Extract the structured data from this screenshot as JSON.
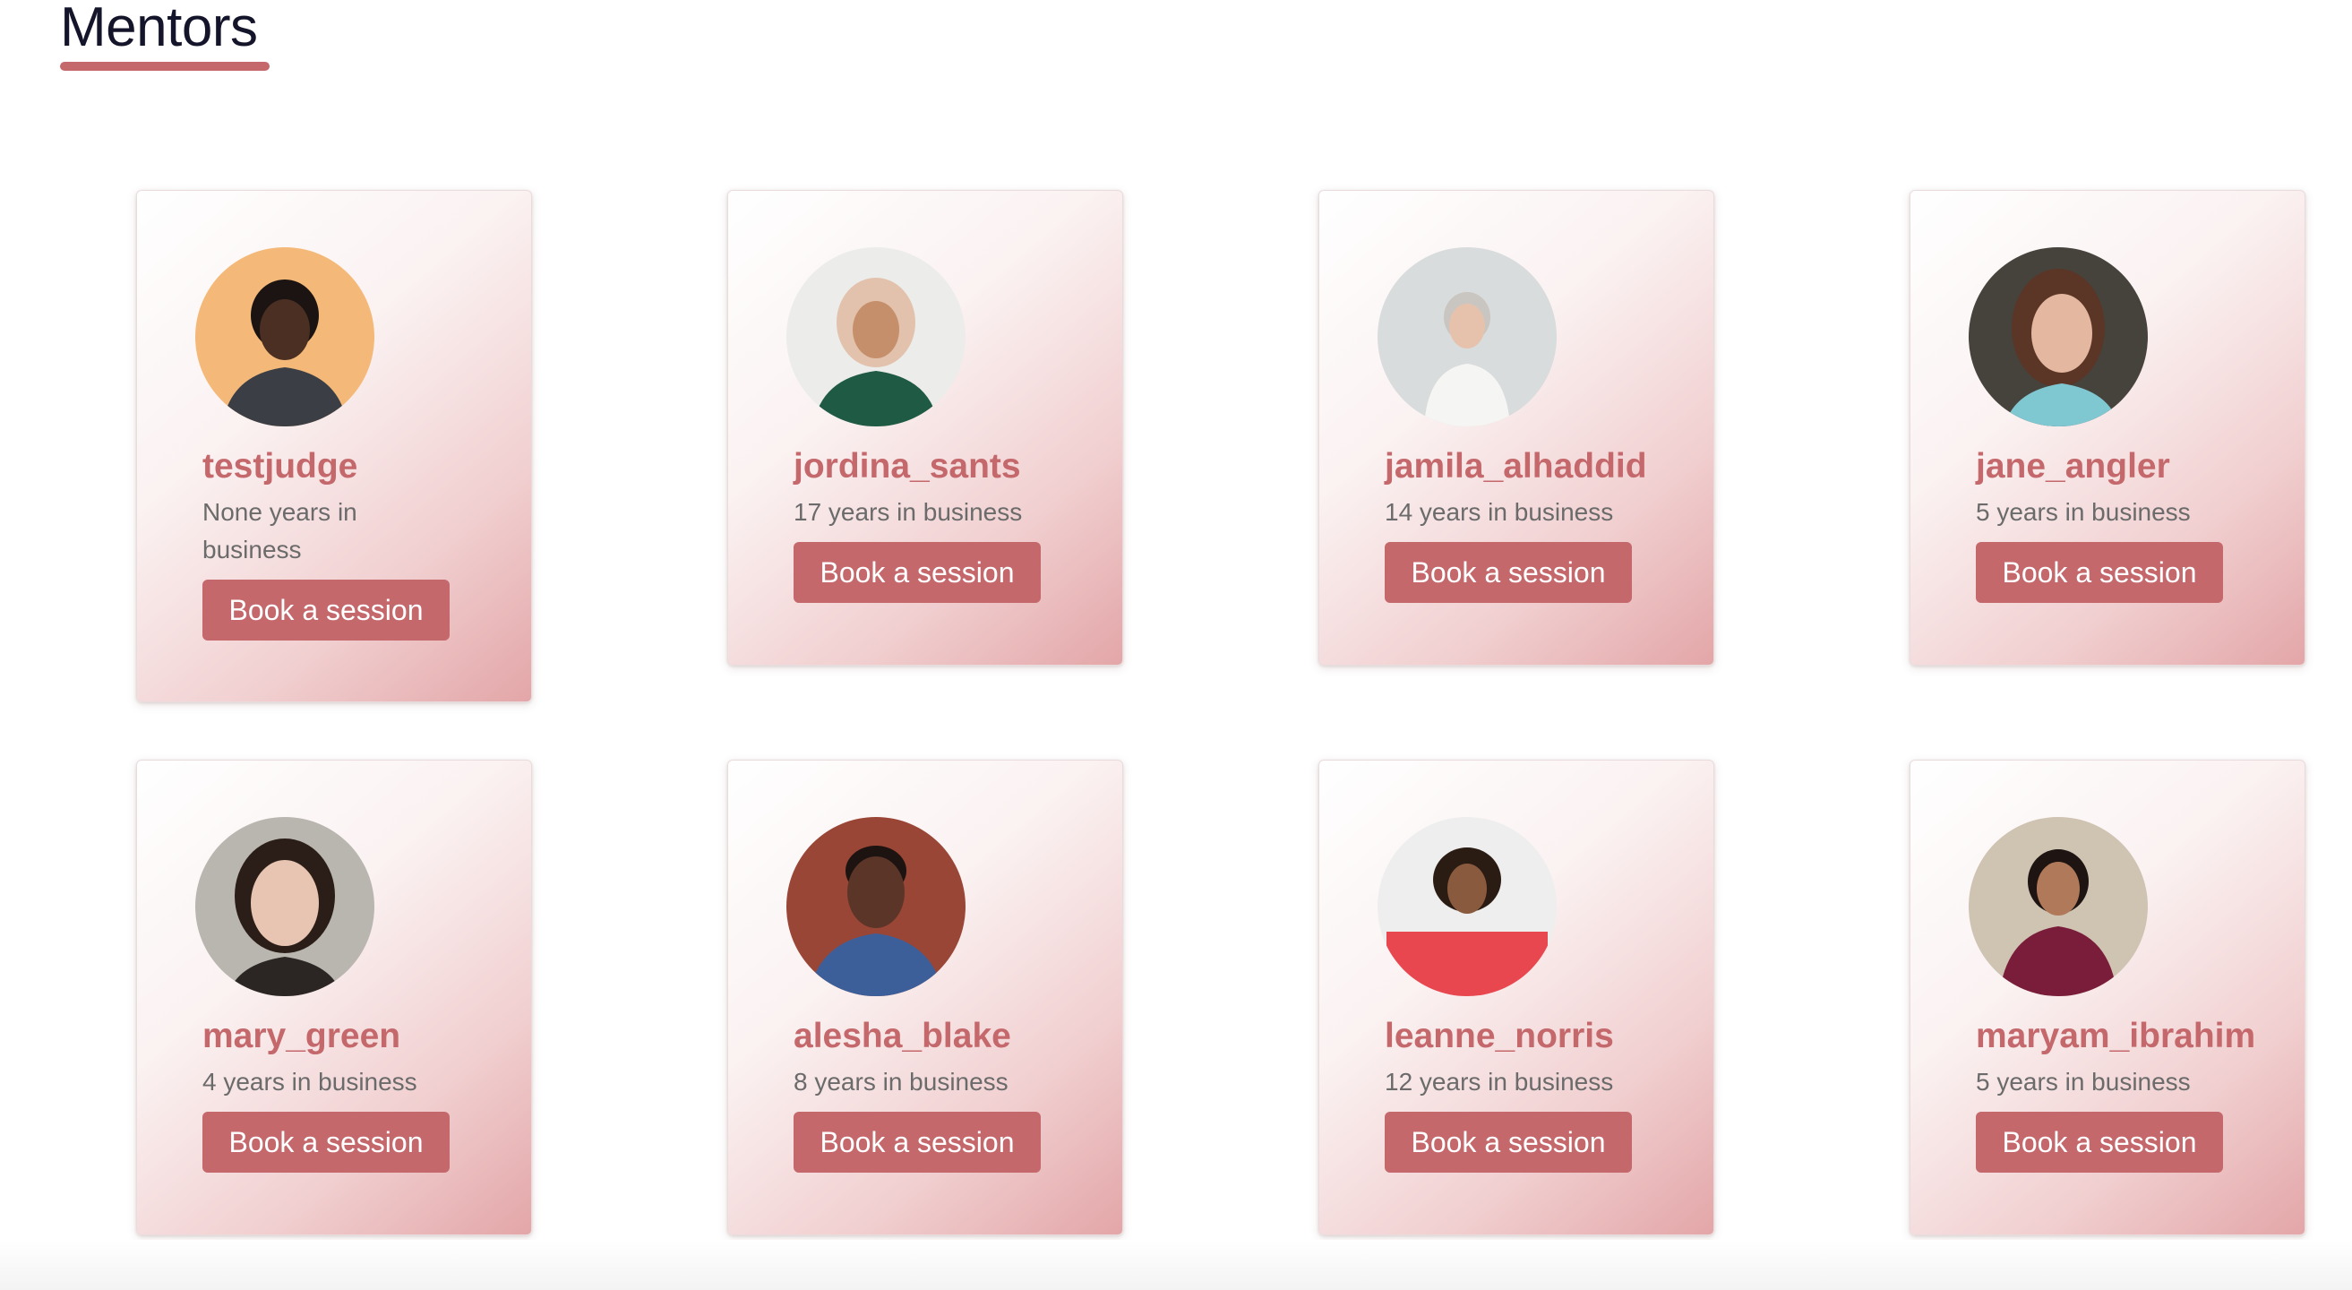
{
  "page": {
    "title": "Mentors"
  },
  "mentors": [
    {
      "name": "testjudge",
      "years": "None years in business",
      "button": "Book a session",
      "photo_bg": "#f4b978",
      "photo_skin": "#4a2f22",
      "photo_cloth": "#3b3f45",
      "photo_hair": "#1b1412"
    },
    {
      "name": "jordina_sants",
      "years": "17 years in business",
      "button": "Book a session",
      "photo_bg": "#ececea",
      "photo_skin": "#c68f6b",
      "photo_cloth": "#1f5a45",
      "photo_hair": "#e2c2ac"
    },
    {
      "name": "jamila_alhaddid",
      "years": "14 years in business",
      "button": "Book a session",
      "photo_bg": "#d9dcdc",
      "photo_skin": "#e6c2ad",
      "photo_cloth": "#f5f5f3",
      "photo_hair": "#c9c6c1"
    },
    {
      "name": "jane_angler",
      "years": "5 years in business",
      "button": "Book a session",
      "photo_bg": "#46423c",
      "photo_skin": "#e3b7a0",
      "photo_cloth": "#7fc7d1",
      "photo_hair": "#5b3526"
    },
    {
      "name": "mary_green",
      "years": "4 years in business",
      "button": "Book a session",
      "photo_bg": "#b9b6b0",
      "photo_skin": "#e8c5b2",
      "photo_cloth": "#2b2623",
      "photo_hair": "#2b1e18"
    },
    {
      "name": "alesha_blake",
      "years": "8 years in business",
      "button": "Book a session",
      "photo_bg": "#9a4637",
      "photo_skin": "#5b3628",
      "photo_cloth": "#3c5f9a",
      "photo_hair": "#1d1310"
    },
    {
      "name": "leanne_norris",
      "years": "12 years in business",
      "button": "Book a session",
      "photo_bg": "#eeeeee",
      "photo_skin": "#8a5a3e",
      "photo_cloth": "#e9474f",
      "photo_hair": "#2b1c13"
    },
    {
      "name": "maryam_ibrahim",
      "years": "5 years in business",
      "button": "Book a session",
      "photo_bg": "#cfc3b2",
      "photo_skin": "#b07a5a",
      "photo_cloth": "#7a1d3a",
      "photo_hair": "#1e1412"
    }
  ]
}
